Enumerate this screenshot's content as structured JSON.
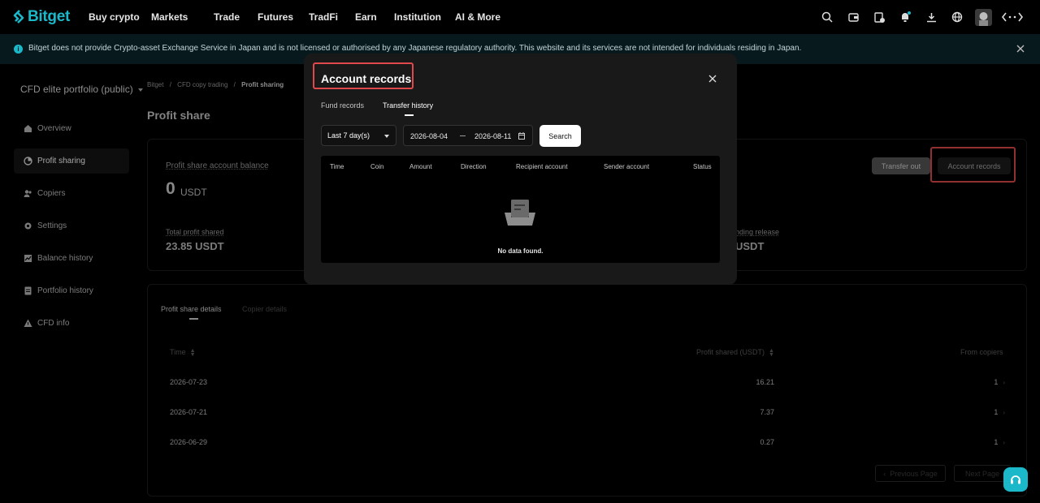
{
  "brand": {
    "name": "Bitget",
    "accent": "#1bb8c9",
    "highlight": "#e0494b"
  },
  "nav": {
    "links": [
      "Buy crypto",
      "Markets",
      "Trade",
      "Futures",
      "TradFi",
      "Earn",
      "Institution",
      "AI & More"
    ],
    "icons": [
      "search-icon",
      "wallet-icon",
      "orders-icon",
      "bell-icon",
      "download-icon",
      "globe-icon",
      "avatar",
      "switch-icon"
    ]
  },
  "banner": {
    "text": "Bitget does not provide Crypto-asset Exchange Service in Japan and is not licensed or authorised by any Japanese regulatory authority. This website and its services are not intended for individuals residing in Japan."
  },
  "sidebar": {
    "portfolio": "CFD elite portfolio (public)",
    "items": [
      {
        "label": "Overview",
        "icon": "home-icon",
        "active": false
      },
      {
        "label": "Profit sharing",
        "icon": "pie-icon",
        "active": true
      },
      {
        "label": "Copiers",
        "icon": "users-icon",
        "active": false
      },
      {
        "label": "Settings",
        "icon": "gear-icon",
        "active": false
      },
      {
        "label": "Balance history",
        "icon": "chart-icon",
        "active": false
      },
      {
        "label": "Portfolio history",
        "icon": "document-icon",
        "active": false
      },
      {
        "label": "CFD info",
        "icon": "info-icon",
        "active": false
      }
    ]
  },
  "breadcrumb": {
    "items": [
      "Bitget",
      "CFD copy trading",
      "Profit sharing"
    ],
    "sep": "/"
  },
  "page": {
    "title": "Profit share"
  },
  "summary": {
    "balance_label": "Profit share account balance",
    "balance_value": "0",
    "balance_unit": "USDT",
    "total_label": "Total profit shared",
    "total_value": "23.85 USDT",
    "pending_label": "nding release",
    "pending_value": "USDT",
    "transfer_out": "Transfer out",
    "account_records": "Account records"
  },
  "details": {
    "tabs": [
      "Profit share details",
      "Copier details"
    ],
    "columns": [
      "Time",
      "Profit shared (USDT)",
      "From copiers"
    ],
    "rows": [
      {
        "time": "2026-07-23",
        "profit": "16.21",
        "copiers": "1"
      },
      {
        "time": "2026-07-21",
        "profit": "7.37",
        "copiers": "1"
      },
      {
        "time": "2026-06-29",
        "profit": "0.27",
        "copiers": "1"
      }
    ],
    "prev": "Previous Page",
    "next": "Next Page"
  },
  "modal": {
    "title": "Account records",
    "tabs": [
      "Fund records",
      "Transfer history"
    ],
    "active_tab": "Transfer history",
    "period": "Last 7 day(s)",
    "date_from": "2026-08-04",
    "date_to": "2026-08-11",
    "search": "Search",
    "columns": [
      "Time",
      "Coin",
      "Amount",
      "Direction",
      "Recipient account",
      "Sender account",
      "Status"
    ],
    "empty": "No data found."
  }
}
